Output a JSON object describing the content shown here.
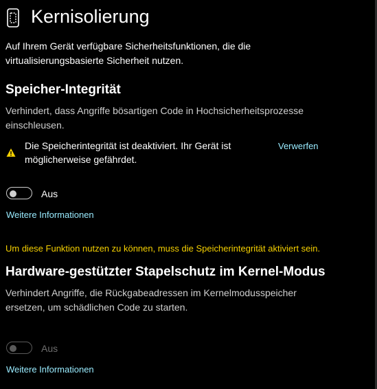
{
  "header": {
    "title": "Kernisolierung",
    "icon": "device-chip-icon"
  },
  "intro": {
    "line1": "Auf Ihrem Gerät verfügbare Sicherheitsfunktionen, die die",
    "line2": "virtualisierungsbasierte Sicherheit nutzen."
  },
  "memory_integrity": {
    "heading": "Speicher-Integrität",
    "desc_line1": "Verhindert, dass Angriffe bösartigen Code in Hochsicherheitsprozesse",
    "desc_line2": "einschleusen.",
    "warning": {
      "icon": "warning-icon",
      "line1": "Die Speicherintegrität ist deaktiviert. Ihr Gerät ist",
      "line2": "möglicherweise gefährdet.",
      "dismiss_label": "Verwerfen"
    },
    "toggle": {
      "state": "off",
      "label": "Aus"
    },
    "more_info": "Weitere Informationen"
  },
  "notice": "Um diese Funktion nutzen zu können, muss die Speicherintegrität aktiviert sein.",
  "stack_protection": {
    "heading": "Hardware-gestützter Stapelschutz im Kernel-Modus",
    "desc_line1": "Verhindert Angriffe, die Rückgabeadressen im Kernelmodusspeicher",
    "desc_line2": "ersetzen, um schädlichen Code zu starten.",
    "toggle": {
      "state": "off",
      "disabled": true,
      "label": "Aus"
    },
    "more_info": "Weitere Informationen"
  },
  "colors": {
    "background": "#000000",
    "link": "#99ebff",
    "notice": "#f5d000",
    "warning": "#f5d000"
  }
}
